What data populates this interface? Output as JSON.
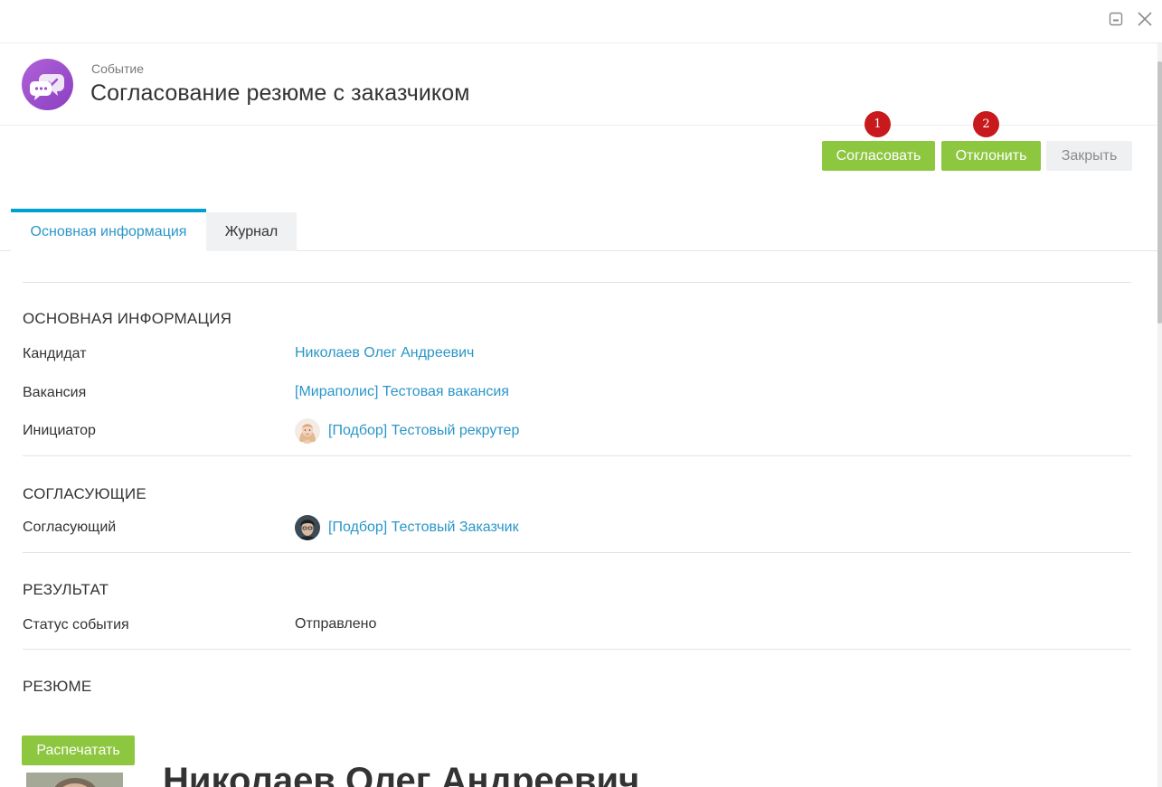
{
  "window": {
    "minimize_icon": "minimize-icon",
    "close_icon": "close-icon"
  },
  "header": {
    "icon": "chat-check-icon",
    "kind": "Событие",
    "title": "Согласование резюме с заказчиком"
  },
  "badges": [
    "1",
    "2"
  ],
  "actions": {
    "approve_label": "Согласовать",
    "reject_label": "Отклонить",
    "close_label": "Закрыть"
  },
  "tabs": [
    {
      "label": "Основная информация",
      "active": true
    },
    {
      "label": "Журнал",
      "active": false
    }
  ],
  "sections": {
    "main": {
      "title": "ОСНОВНАЯ ИНФОРМАЦИЯ",
      "candidate_label": "Кандидат",
      "candidate_value": "Николаев Олег Андреевич",
      "vacancy_label": "Вакансия",
      "vacancy_value": "[Мираполис] Тестовая вакансия",
      "initiator_label": "Инициатор",
      "initiator_value": "[Подбор] Тестовый рекрутер"
    },
    "approvers": {
      "title": "СОГЛАСУЮЩИЕ",
      "approver_label": "Согласующий",
      "approver_value": "[Подбор] Тестовый Заказчик"
    },
    "result": {
      "title": "РЕЗУЛЬТАТ",
      "status_label": "Статус события",
      "status_value": "Отправлено"
    },
    "resume": {
      "title": "РЕЗЮМЕ",
      "print_label": "Распечатать",
      "candidate_name": "Николаев Олег Андреевич"
    }
  },
  "colors": {
    "accent_green": "#8dc63f",
    "link_blue": "#2a96c8",
    "tab_active_border": "#00a0d2",
    "badge_red": "#c8191c",
    "icon_purple": "#9b4fcb"
  }
}
